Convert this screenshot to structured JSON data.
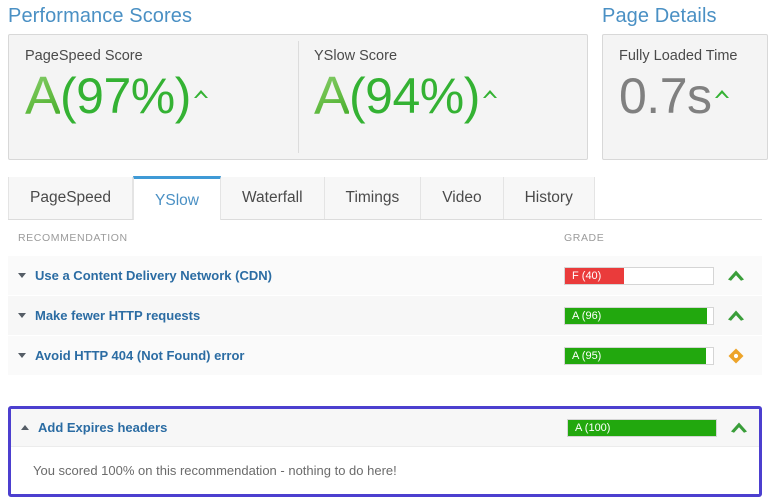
{
  "performance": {
    "heading": "Performance Scores",
    "cards": [
      {
        "label": "PageSpeed Score",
        "grade": "A",
        "value": "(97%)",
        "trend_icon": "caret-up-icon",
        "trend_color": "#34b233"
      },
      {
        "label": "YSlow Score",
        "grade": "A",
        "value": "(94%)",
        "trend_icon": "caret-up-icon",
        "trend_color": "#34b233"
      }
    ]
  },
  "page_details": {
    "heading": "Page Details",
    "cards": [
      {
        "label": "Fully Loaded Time",
        "value": "0.7s",
        "trend_icon": "caret-up-icon",
        "trend_color": "#34b233"
      }
    ]
  },
  "tabs": [
    {
      "label": "PageSpeed",
      "active": false
    },
    {
      "label": "YSlow",
      "active": true
    },
    {
      "label": "Waterfall",
      "active": false
    },
    {
      "label": "Timings",
      "active": false
    },
    {
      "label": "Video",
      "active": false
    },
    {
      "label": "History",
      "active": false
    }
  ],
  "table": {
    "columns": {
      "recommendation": "RECOMMENDATION",
      "grade": "GRADE"
    },
    "rows": [
      {
        "label": "Use a Content Delivery Network (CDN)",
        "toggle_icon": "triangle-down-icon",
        "expanded": false,
        "grade_text": "F (40)",
        "grade_value": 40,
        "grade_color": "#ea3b3b",
        "status_icon": "chevron-up-icon",
        "status_color": "#3a9e3a"
      },
      {
        "label": "Make fewer HTTP requests",
        "toggle_icon": "triangle-down-icon",
        "expanded": false,
        "grade_text": "A (96)",
        "grade_value": 96,
        "grade_color": "#22a80e",
        "status_icon": "chevron-up-icon",
        "status_color": "#3a9e3a"
      },
      {
        "label": "Avoid HTTP 404 (Not Found) error",
        "toggle_icon": "triangle-down-icon",
        "expanded": false,
        "grade_text": "A (95)",
        "grade_value": 95,
        "grade_color": "#22a80e",
        "status_icon": "diamond-icon",
        "status_color": "#eda42a"
      }
    ],
    "highlighted_row": {
      "label": "Add Expires headers",
      "toggle_icon": "triangle-up-icon",
      "expanded": true,
      "grade_text": "A (100)",
      "grade_value": 100,
      "grade_color": "#22a80e",
      "status_icon": "chevron-up-icon",
      "status_color": "#3a9e3a",
      "highlight_color": "#4c3fcf",
      "detail_text": "You scored 100% on this recommendation - nothing to do here!"
    }
  }
}
